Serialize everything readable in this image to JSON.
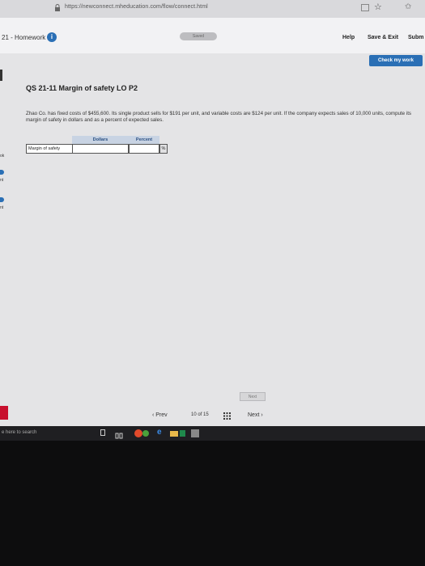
{
  "browser": {
    "url": "https://newconnect.mheducation.com/flow/connect.html"
  },
  "header": {
    "title": "21 - Homework",
    "info_glyph": "i",
    "saved": "Saved",
    "help": "Help",
    "save_exit": "Save & Exit",
    "submit": "Subm"
  },
  "check_work": "Check my work",
  "sidebar": {
    "labels": [
      "ok",
      "nt",
      "nt"
    ]
  },
  "question": {
    "title": "QS 21-11 Margin of safety LO P2",
    "text": "Zhao Co. has fixed costs of $455,600. Its single product sells for $191 per unit, and variable costs are $124 per unit. If the company expects sales of 10,000 units, compute its margin of safety in dollars and as a percent of expected sales."
  },
  "table": {
    "headers": [
      "Dollars",
      "Percent"
    ],
    "row_label": "Margin of safety",
    "dollars_value": "",
    "percent_value": "",
    "percent_symbol": "%"
  },
  "nav": {
    "next_button": "Next",
    "prev": "Prev",
    "page_current": "10",
    "page_of": "of",
    "page_total": "15",
    "next": "Next"
  },
  "taskbar": {
    "search": "e here to search"
  },
  "colors": {
    "accent": "#2a6fb5",
    "brand": "#c8102e"
  }
}
